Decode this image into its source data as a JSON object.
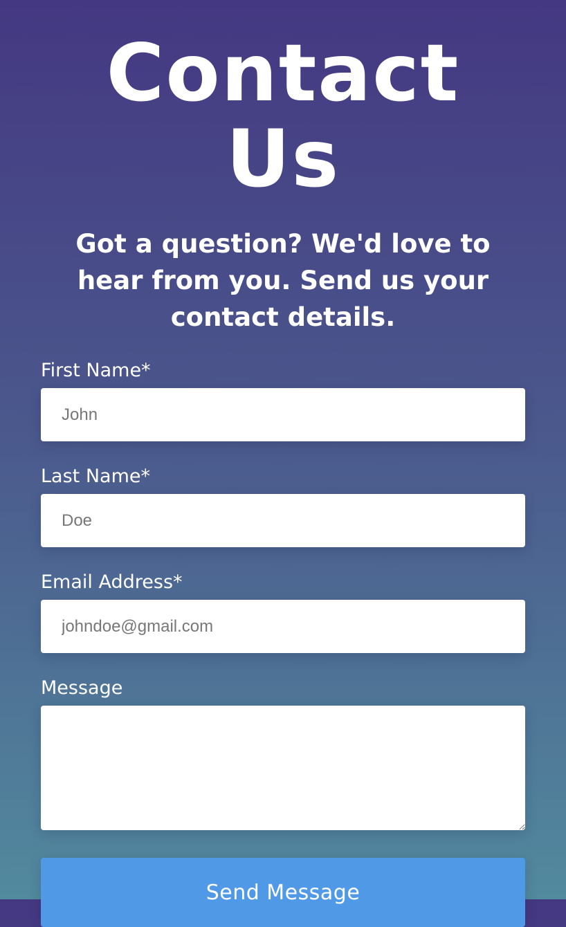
{
  "page": {
    "title": "Contact Us",
    "subtitle": "Got a question? We'd love to hear from you. Send us your contact details."
  },
  "form": {
    "first_name": {
      "label": "First Name*",
      "placeholder": "John",
      "value": ""
    },
    "last_name": {
      "label": "Last Name*",
      "placeholder": "Doe",
      "value": ""
    },
    "email": {
      "label": "Email Address*",
      "placeholder": "johndoe@gmail.com",
      "value": ""
    },
    "message": {
      "label": "Message",
      "placeholder": "",
      "value": ""
    },
    "submit_label": "Send Message"
  },
  "colors": {
    "background_top": "#443882",
    "background_bottom": "#528a9e",
    "button": "#4f99e7",
    "text": "#ffffff",
    "input_background": "#ffffff"
  }
}
